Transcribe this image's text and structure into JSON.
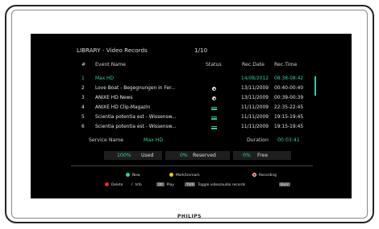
{
  "tv": {
    "brand": "PHILIPS"
  },
  "header": {
    "title": "LIBRARY - Video Records",
    "page": "1/10"
  },
  "columns": {
    "num": "#",
    "name": "Event Name",
    "status": "Status",
    "date": "Rec.Date",
    "time": "Rec.Time"
  },
  "rows": [
    {
      "num": "1",
      "name": "Max HD",
      "status_icon": "",
      "date": "14/08/2012",
      "time": "08:38-08:42"
    },
    {
      "num": "2",
      "name": "Love Boat - Begegnungen in Fer...",
      "status_icon": "disk-icon",
      "date": "13/11/2009",
      "time": "00:40-00:40"
    },
    {
      "num": "3",
      "name": "ANIXE HD News",
      "status_icon": "disk-icon",
      "date": "13/11/2009",
      "time": "00:39-00:39"
    },
    {
      "num": "4",
      "name": "ANIXE HD Clip-Magazin",
      "status_icon": "equal-icon",
      "date": "11/11/2009",
      "time": "22:35-22:45"
    },
    {
      "num": "5",
      "name": "Scientia potentia est - Wissensw...",
      "status_icon": "equal-icon",
      "date": "11/11/2009",
      "time": "19:15-19:45"
    },
    {
      "num": "6",
      "name": "Scientia potentia est - Wissensw...",
      "status_icon": "equal-icon",
      "date": "11/11/2009",
      "time": "19:15-19:45"
    }
  ],
  "service": {
    "label": "Service Name",
    "value": "Max HD",
    "duration_label": "Duration",
    "duration_value": "00:03:41"
  },
  "usage": {
    "used_value": "100%",
    "used_label": "Used",
    "reserved_value": "0%",
    "reserved_label": "Reserved",
    "free_value": "0%",
    "free_label": "Free"
  },
  "legend": {
    "new": "New",
    "mark": "Mark/Unmark",
    "recording": "Recording",
    "delete": "Delete",
    "info": "Info",
    "ok_key": "OK",
    "play": "Play",
    "tvr_key": "TV/R",
    "toggle": "Toggle video/audio records",
    "back": "Back"
  },
  "colors": {
    "accent": "#38c9a8",
    "red": "#e03030",
    "yellow": "#e6c230",
    "green": "#38c9a8"
  }
}
